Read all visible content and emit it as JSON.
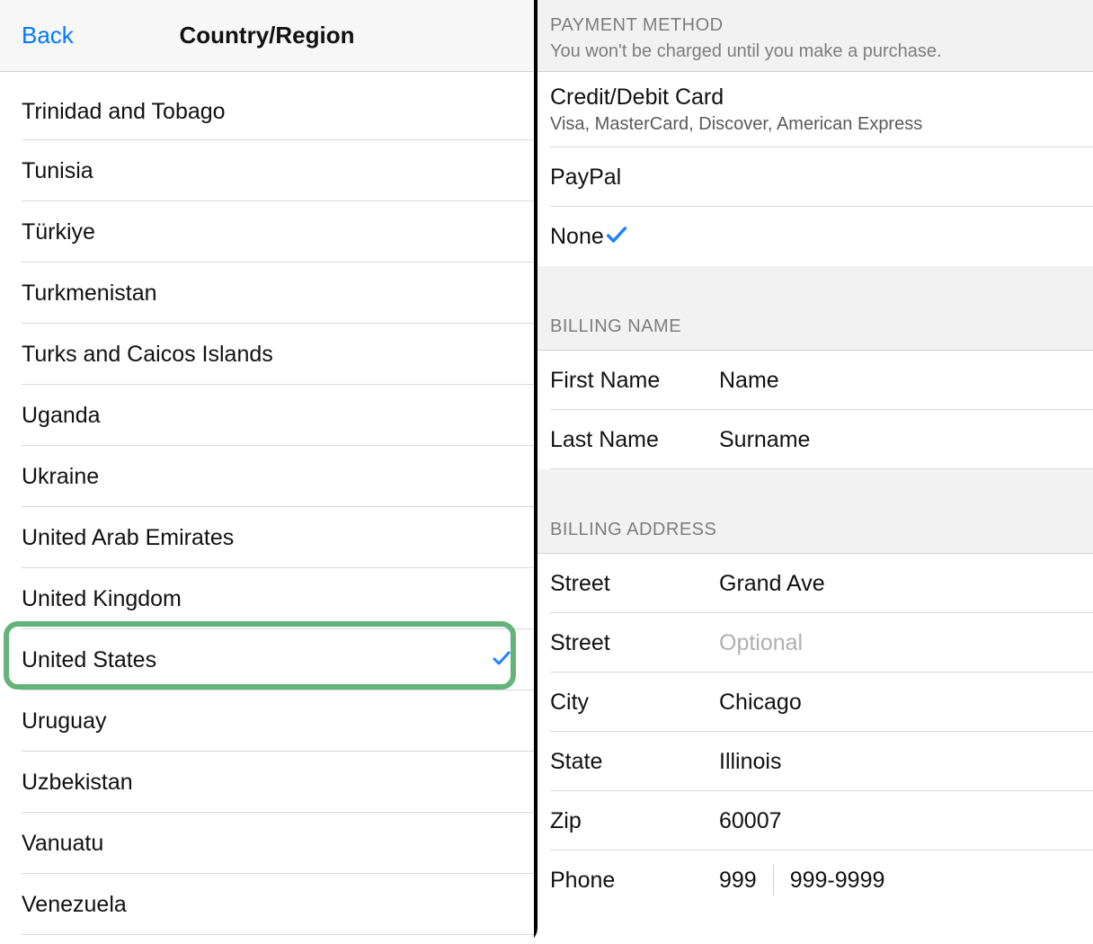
{
  "left": {
    "back": "Back",
    "title": "Country/Region",
    "countries": [
      {
        "name": "Trinidad and Tobago",
        "selected": false
      },
      {
        "name": "Tunisia",
        "selected": false
      },
      {
        "name": "Türkiye",
        "selected": false
      },
      {
        "name": "Turkmenistan",
        "selected": false
      },
      {
        "name": "Turks and Caicos Islands",
        "selected": false
      },
      {
        "name": "Uganda",
        "selected": false
      },
      {
        "name": "Ukraine",
        "selected": false
      },
      {
        "name": "United Arab Emirates",
        "selected": false
      },
      {
        "name": "United Kingdom",
        "selected": false
      },
      {
        "name": "United States",
        "selected": true
      },
      {
        "name": "Uruguay",
        "selected": false
      },
      {
        "name": "Uzbekistan",
        "selected": false
      },
      {
        "name": "Vanuatu",
        "selected": false
      },
      {
        "name": "Venezuela",
        "selected": false
      }
    ]
  },
  "right": {
    "payment": {
      "header": "PAYMENT METHOD",
      "sub": "You won't be charged until you make a purchase.",
      "options": [
        {
          "title": "Credit/Debit Card",
          "sub": "Visa, MasterCard, Discover, American Express",
          "selected": false
        },
        {
          "title": "PayPal",
          "sub": "",
          "selected": false
        },
        {
          "title": "None",
          "sub": "",
          "selected": true
        }
      ]
    },
    "billingName": {
      "header": "BILLING NAME",
      "rows": [
        {
          "label": "First Name",
          "value": "Name",
          "placeholder": ""
        },
        {
          "label": "Last Name",
          "value": "Surname",
          "placeholder": ""
        }
      ]
    },
    "billingAddress": {
      "header": "BILLING ADDRESS",
      "rows": [
        {
          "label": "Street",
          "value": "Grand Ave",
          "placeholder": ""
        },
        {
          "label": "Street",
          "value": "",
          "placeholder": "Optional"
        },
        {
          "label": "City",
          "value": "Chicago",
          "placeholder": ""
        },
        {
          "label": "State",
          "value": "Illinois",
          "placeholder": ""
        },
        {
          "label": "Zip",
          "value": "60007",
          "placeholder": ""
        }
      ],
      "phone": {
        "label": "Phone",
        "area": "999",
        "number": "999-9999"
      }
    }
  }
}
